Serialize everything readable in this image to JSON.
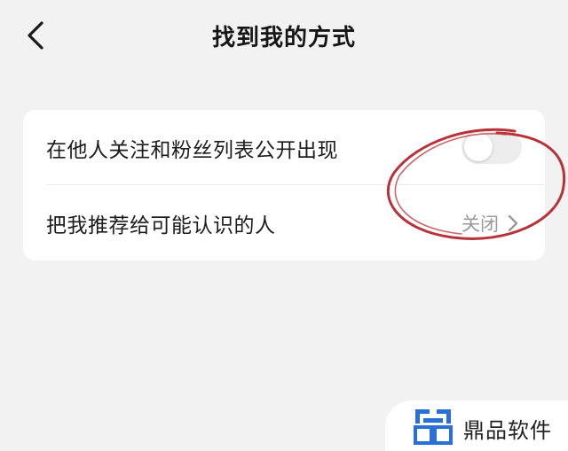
{
  "header": {
    "title": "找到我的方式",
    "back_icon": "chevron-left-icon"
  },
  "settings": {
    "follow_list_visibility": {
      "label": "在他人关注和粉丝列表公开出现",
      "toggle_state": "off"
    },
    "recommend_to_acquaintances": {
      "label": "把我推荐给可能认识的人",
      "value": "关闭",
      "chevron_icon": "chevron-right-icon"
    }
  },
  "annotation": {
    "type": "hand-drawn-circle",
    "color": "#b8323a"
  },
  "watermark": {
    "text": "鼎品软件",
    "logo_icon": "qr-style-logo-icon",
    "logo_color": "#2a6fd6"
  },
  "colors": {
    "background": "#f2f2f2",
    "card": "#ffffff",
    "secondary_text": "#9a9a9a"
  }
}
